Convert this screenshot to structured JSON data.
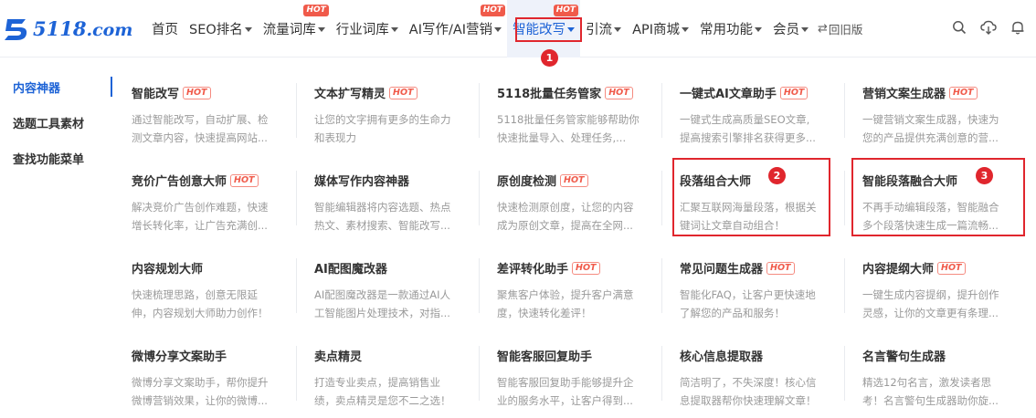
{
  "brand": {
    "logo_text": "5118",
    "logo_domain": ".com",
    "accent": "#1d63d6",
    "annot": "#e0262d"
  },
  "nav": {
    "items": [
      {
        "label": "首页",
        "caret": false,
        "hot": ""
      },
      {
        "label": "SEO排名",
        "caret": true,
        "hot": ""
      },
      {
        "label": "流量词库",
        "caret": true,
        "hot": "HOT"
      },
      {
        "label": "行业词库",
        "caret": true,
        "hot": ""
      },
      {
        "label": "AI写作/AI营销",
        "caret": true,
        "hot": "HOT"
      },
      {
        "label": "智能改写",
        "caret": true,
        "hot": "HOT",
        "active": true
      },
      {
        "label": "引流",
        "caret": true,
        "hot": ""
      },
      {
        "label": "API商城",
        "caret": true,
        "hot": ""
      },
      {
        "label": "常用功能",
        "caret": true,
        "hot": ""
      },
      {
        "label": "会员",
        "caret": true,
        "hot": ""
      }
    ],
    "old_version": "回旧版",
    "annotation_1": "1"
  },
  "toolbar": {
    "icons": [
      "search-icon",
      "cloud-download-icon",
      "bell-icon"
    ]
  },
  "sidebar": {
    "items": [
      {
        "label": "内容神器",
        "active": true
      },
      {
        "label": "选题工具素材",
        "active": false
      },
      {
        "label": "查找功能菜单",
        "active": false
      }
    ]
  },
  "grid": {
    "hot_label": "HOT",
    "rows": [
      [
        {
          "title": "智能改写",
          "hot": true,
          "desc": [
            "通过智能改写，自动扩展、检",
            "测文章内容，快速提高网站..."
          ]
        },
        {
          "title": "文本扩写精灵",
          "hot": true,
          "desc": [
            "让您的文字拥有更多的生命力",
            "和表现力"
          ]
        },
        {
          "title": "5118批量任务管家",
          "hot": true,
          "desc": [
            "5118批量任务管家能够帮助你",
            "快速批量导入、处理任务,..."
          ]
        },
        {
          "title": "一键式AI文章助手",
          "hot": true,
          "desc": [
            "一键式生成高质量SEO文章,",
            "提高搜索引擎排名获得更多..."
          ]
        },
        {
          "title": "营销文案生成器",
          "hot": true,
          "desc": [
            "一键营销文案生成器，快速为",
            "您的产品提供充满创意的营..."
          ]
        }
      ],
      [
        {
          "title": "竞价广告创意大师",
          "hot": true,
          "desc": [
            "解决竞价广告创作难题，快速",
            "增长转化率，让广告充满创..."
          ]
        },
        {
          "title": "媒体写作内容神器",
          "hot": false,
          "desc": [
            "智能编辑器将内容选题、热点",
            "热文、素材搜索、智能改写..."
          ]
        },
        {
          "title": "原创度检测",
          "hot": true,
          "desc": [
            "快速检测原创度，让您的内容",
            "成为原创文章，提高在全网..."
          ]
        },
        {
          "title": "段落组合大师",
          "hot": false,
          "annot": "2",
          "desc": [
            "汇聚互联网海量段落，根据关",
            "键词让文章自动组合！"
          ]
        },
        {
          "title": "智能段落融合大师",
          "hot": false,
          "annot": "3",
          "desc": [
            "不再手动编辑段落，智能融合",
            "多个段落快速生成一篇流畅..."
          ]
        }
      ],
      [
        {
          "title": "内容规划大师",
          "hot": false,
          "desc": [
            "快速梳理思路，创意无限延",
            "伸，内容规划大师助力创作！"
          ]
        },
        {
          "title": "AI配图魔改器",
          "hot": false,
          "desc": [
            "AI配图魔改器是一款通过AI人",
            "工智能图片处理技术，对指..."
          ]
        },
        {
          "title": "差评转化助手",
          "hot": true,
          "desc": [
            "聚焦客户体验，提升客户满意",
            "度，快速转化差评！"
          ]
        },
        {
          "title": "常见问题生成器",
          "hot": true,
          "desc": [
            "智能化FAQ，让客户更快速地",
            "了解您的产品和服务！"
          ]
        },
        {
          "title": "内容提纲大师",
          "hot": true,
          "desc": [
            "一键生成内容提纲，提升创作",
            "灵感，让你的文章更有条理..."
          ]
        }
      ],
      [
        {
          "title": "微博分享文案助手",
          "hot": false,
          "desc": [
            "微博分享文案助手，帮你提升",
            "微博营销效果，让你的微博..."
          ]
        },
        {
          "title": "卖点精灵",
          "hot": false,
          "desc": [
            "打造专业卖点，提高销售业",
            "绩，卖点精灵是您不二之选！"
          ]
        },
        {
          "title": "智能客服回复助手",
          "hot": false,
          "desc": [
            "智能客服回复助手能够提升企",
            "业的服务水平，让客户得到..."
          ]
        },
        {
          "title": "核心信息提取器",
          "hot": false,
          "desc": [
            "简洁明了，不失深度！核心信",
            "息提取器帮你快速理解文章！"
          ]
        },
        {
          "title": "名言警句生成器",
          "hot": false,
          "desc": [
            "精选12句名言，激发读者思",
            "考！名言警句生成器助你旋..."
          ]
        }
      ]
    ]
  }
}
